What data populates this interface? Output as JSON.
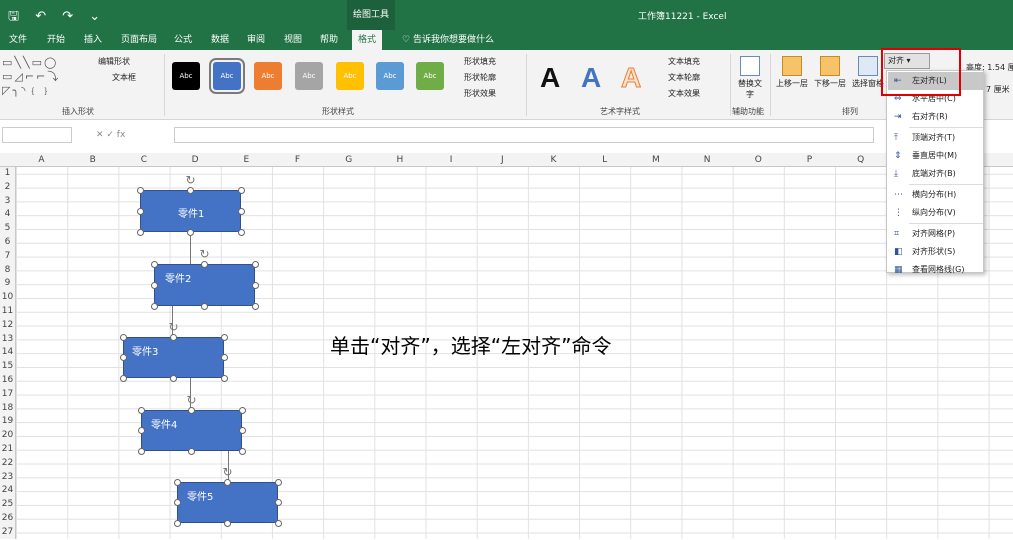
{
  "titlebar": {
    "qat": "🖫 ↶ ↷ ⌄",
    "context_tab_label": "绘图工具",
    "doc_title": "工作簿11221 - Excel"
  },
  "tabs": [
    "文件",
    "开始",
    "插入",
    "页面布局",
    "公式",
    "数据",
    "审阅",
    "视图",
    "帮助",
    "格式"
  ],
  "tell_me": "告诉我你想要做什么",
  "ribbon": {
    "insert_shapes": {
      "label": "插入形状",
      "edit_shape": "编辑形状",
      "textbox": "文本框"
    },
    "shape_styles": {
      "label": "形状样式",
      "swatch": "Abc",
      "fill": "形状填充",
      "outline": "形状轮廓",
      "effect": "形状效果",
      "colors": [
        "#000000",
        "#4472c4",
        "#ed7d31",
        "#a5a5a5",
        "#ffc000",
        "#5b9bd5",
        "#70ad47"
      ]
    },
    "wordart": {
      "label": "艺术字样式",
      "letter": "A",
      "text_fill": "文本填充",
      "text_outline": "文本轮廓",
      "text_effect": "文本效果"
    },
    "accessibility": {
      "label": "辅助功能",
      "alt_text": "替换文字"
    },
    "arrange": {
      "label": "排列",
      "bring_forward": "上移一层",
      "send_backward": "下移一层",
      "selection_pane": "选择窗格",
      "align": "对齐"
    },
    "size": {
      "height_label": "高度:",
      "height_value": "1.54 厘米",
      "width_value": "7 厘米"
    }
  },
  "formula_bar": {
    "fx": "✕ ✓ fx"
  },
  "columns": [
    "A",
    "B",
    "C",
    "D",
    "E",
    "F",
    "G",
    "H",
    "I",
    "J",
    "K",
    "L",
    "M",
    "N",
    "O",
    "P",
    "Q"
  ],
  "rows": [
    "1",
    "2",
    "3",
    "4",
    "5",
    "6",
    "7",
    "8",
    "9",
    "10",
    "11",
    "12",
    "13",
    "14",
    "15",
    "16",
    "17",
    "18",
    "19",
    "20",
    "21",
    "22",
    "23",
    "24",
    "25",
    "26",
    "27"
  ],
  "shapes": [
    "零件1",
    "零件2",
    "零件3",
    "零件4",
    "零件5"
  ],
  "annotation": "单击“对齐”，选择“左对齐”命令",
  "align_menu": [
    {
      "label": "左对齐(L)",
      "icon": "⇤"
    },
    {
      "label": "水平居中(C)",
      "icon": "⇔"
    },
    {
      "label": "右对齐(R)",
      "icon": "⇥"
    },
    {
      "label": "顶端对齐(T)",
      "icon": "⤒"
    },
    {
      "label": "垂直居中(M)",
      "icon": "⇕"
    },
    {
      "label": "底端对齐(B)",
      "icon": "⤓"
    },
    {
      "label": "横向分布(H)",
      "icon": "⋯"
    },
    {
      "label": "纵向分布(V)",
      "icon": "⋮"
    },
    {
      "label": "对齐网格(P)",
      "icon": "⌗"
    },
    {
      "label": "对齐形状(S)",
      "icon": "◧"
    },
    {
      "label": "查看网格线(G)",
      "icon": "▦"
    }
  ]
}
